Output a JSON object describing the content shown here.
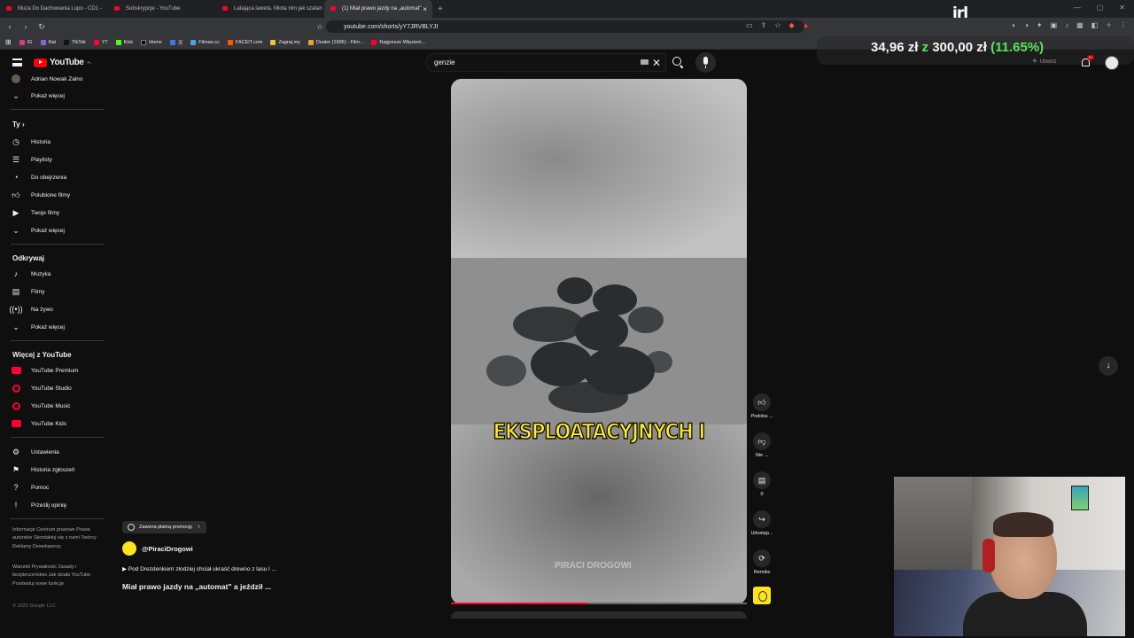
{
  "browser": {
    "tabs": [
      {
        "title": "Muza Do Dachowania Lupo - CD1 -",
        "active": false
      },
      {
        "title": "Subskrypcje - YouTube",
        "active": false
      },
      {
        "title": "Latająca laweta. Miota nim jak szatan",
        "active": false
      },
      {
        "title": "(1) Miał prawo jazdy na „automat\"",
        "active": true
      }
    ],
    "url": "youtube.com/shorts/yY7JRVBLYJI",
    "bookmarks": [
      "IG",
      "Rat",
      "TikTok",
      "YT",
      "Kick",
      "Home",
      "灭",
      "Filman.cc",
      "FACEIT.com",
      "Zagraj.my",
      "Dealer (1996) - Film...",
      "Najgorsze Więzieni..."
    ]
  },
  "overlay": {
    "logo": "irl",
    "current": "34,96 zł",
    "sep": "z",
    "goal": "300,00 zł",
    "percent": "(11.65%)"
  },
  "header": {
    "logo_text": "YouTube",
    "logo_region": "PL",
    "search_value": "genzie",
    "create_label": "Utwórz",
    "notif_count": "9+"
  },
  "sidebar": {
    "top_channel": "Adrian Nowak Zalno",
    "show_more": "Pokaż więcej",
    "you_section": "Ty",
    "you_items": [
      "Historia",
      "Playlisty",
      "Do obejrzenia",
      "Polubione filmy",
      "Twoje filmy",
      "Pokaż więcej"
    ],
    "explore_section": "Odkrywaj",
    "explore_items": [
      "Muzyka",
      "Filmy",
      "Na żywo",
      "Pokaż więcej"
    ],
    "more_section": "Więcej z YouTube",
    "more_items": [
      "YouTube Premium",
      "YouTube Studio",
      "YouTube Music",
      "YouTube Kids"
    ],
    "settings_items": [
      "Ustawienia",
      "Historia zgłoszeń",
      "Pomoc",
      "Prześlij opinię"
    ],
    "footer1": "Informacje  Centrum prasowe  Prawa autorskie  Skontaktuj się z nami  Twórcy  Reklamy  Deweloperzy",
    "footer2": "Warunki  Prywatność  Zasady i bezpieczeństwo  Jak działa YouTube  Przetestuj nowe funkcje",
    "copyright": "© 2025 Google LLC"
  },
  "short": {
    "caption": "EKSPLOATACYJNYCH I",
    "watermark": "PIRACI DROGOWI",
    "promo_label": "Zawiera płatną promocję",
    "channel": "@PiraciDrogowi",
    "description": "▶ Pod Drezdenkiem złodziej chciał ukraść drewno z lasu I ...",
    "title": "Miał prawo jazdy na „automat\" a jeździł ...",
    "progress": 0.46
  },
  "actions": {
    "like": "Podoba ...",
    "dislike": "Nie ...",
    "comments": "0",
    "share": "Udostęp...",
    "remix": "Remiks"
  }
}
